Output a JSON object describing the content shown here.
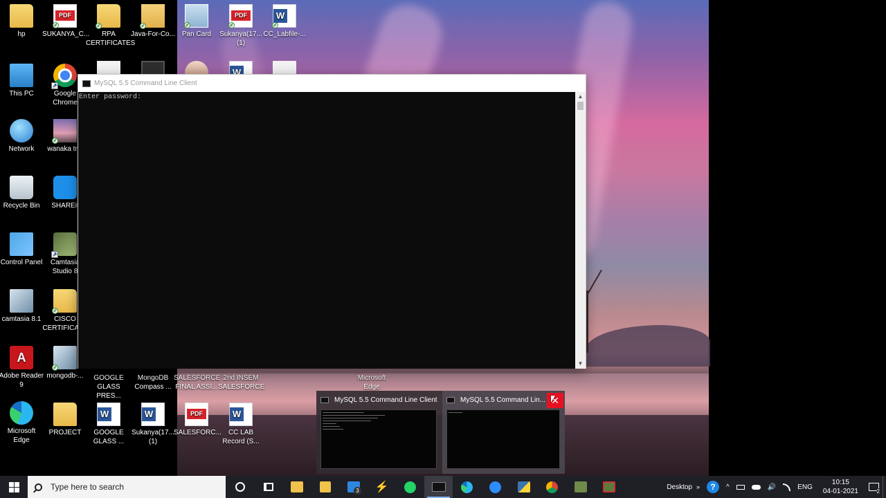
{
  "desktop": {
    "icons": [
      {
        "label": "hp",
        "type": "folder"
      },
      {
        "label": "SUKANYA_C...",
        "type": "pdf"
      },
      {
        "label": "RPA CERTIFICATES",
        "type": "folder"
      },
      {
        "label": "Java-For-Co...",
        "type": "zip"
      },
      {
        "label": "Pan Card",
        "type": "card"
      },
      {
        "label": "Sukanya(17... (1)",
        "type": "pdf"
      },
      {
        "label": "CC_Labfile-...",
        "type": "word"
      },
      {
        "label": "This PC",
        "type": "pc"
      },
      {
        "label": "Google Chrome",
        "type": "chrome"
      },
      {
        "label": "Network",
        "type": "globe"
      },
      {
        "label": "wanaka tr...",
        "type": "photo"
      },
      {
        "label": "Recycle Bin",
        "type": "bin"
      },
      {
        "label": "SHAREit",
        "type": "shareit"
      },
      {
        "label": "Control Panel",
        "type": "panel"
      },
      {
        "label": "Camtasia Studio 8",
        "type": "camtasia"
      },
      {
        "label": "camtasia 8.1",
        "type": "installer"
      },
      {
        "label": "CISCO CERTIFICAT...",
        "type": "folder"
      },
      {
        "label": "Adobe Reader 9",
        "type": "adobe"
      },
      {
        "label": "mongodb-...",
        "type": "installer"
      },
      {
        "label": "GOOGLE GLASS PRES...",
        "type": "blank"
      },
      {
        "label": "MongoDB Compass ...",
        "type": "blank"
      },
      {
        "label": "SALESFORCE FINAL ASSI...",
        "type": "blank"
      },
      {
        "label": "2nd INSEM SALESFORCE",
        "type": "blank"
      },
      {
        "label": "Microsoft Edge",
        "type": "edge"
      },
      {
        "label": "Microsoft Edge",
        "type": "edge"
      },
      {
        "label": "PROJECT",
        "type": "folder"
      },
      {
        "label": "GOOGLE GLASS ...",
        "type": "word"
      },
      {
        "label": "Sukanya(17... (1)",
        "type": "word"
      },
      {
        "label": "SALESFORC...",
        "type": "pdf"
      },
      {
        "label": "CC LAB Record (S...",
        "type": "word"
      }
    ]
  },
  "mysql_window": {
    "title": "MySQL 5.5 Command Line Client",
    "console_text": "Enter password:"
  },
  "preview": {
    "items": [
      {
        "title": "MySQL 5.5 Command Line Client"
      },
      {
        "title": "MySQL 5.5 Command Lin..."
      }
    ],
    "close_glyph": "✕"
  },
  "taskbar": {
    "search_placeholder": "Type here to search",
    "mail_badge": "3",
    "desktop_label": "Desktop",
    "language": "ENG",
    "time": "10:15",
    "date": "04-01-2021",
    "notification_badge": "2"
  },
  "colors": {
    "taskbar": "#1f1f26",
    "console_bg": "#0c0c0c",
    "close_red": "#e81123",
    "accent": "#8ab4f8"
  }
}
